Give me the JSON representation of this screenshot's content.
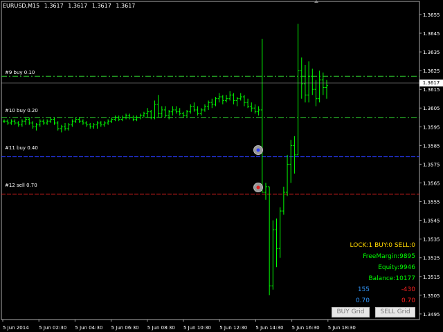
{
  "header": {
    "symbol": "EURUSD,M15",
    "ohlc": [
      "1.3617",
      "1.3617",
      "1.3617",
      "1.3617"
    ]
  },
  "orders": [
    {
      "label": "#9 buy 0.10",
      "price": 1.3622,
      "color": "#2ecc2e"
    },
    {
      "label": "#10 buy 0.20",
      "price": 1.36,
      "color": "#2ecc2e"
    },
    {
      "label": "#11 buy 0.40",
      "price": 1.3579,
      "color": "#2a3cff"
    },
    {
      "label": "#12 sell 0.70",
      "price": 1.3559,
      "color": "#e02020"
    }
  ],
  "price_axis": {
    "labels": [
      "1.3655",
      "1.3645",
      "1.3635",
      "1.3625",
      "1.3615",
      "1.3605",
      "1.3595",
      "1.3585",
      "1.3575",
      "1.3565",
      "1.3555",
      "1.3545",
      "1.3535",
      "1.3525",
      "1.3515",
      "1.3505",
      "1.3495"
    ],
    "current_price": "1.3617"
  },
  "time_axis": {
    "labels": [
      "5 Jun 2014",
      "5 Jun 02:30",
      "5 Jun 04:30",
      "5 Jun 06:30",
      "5 Jun 08:30",
      "5 Jun 10:30",
      "5 Jun 12:30",
      "5 Jun 14:30",
      "5 Jun 16:30",
      "5 Jun 18:30"
    ]
  },
  "indicator": {
    "status_line": "LOCK:1  BUY:0  SELL:0",
    "free_margin": "FreeMargin:9895",
    "equity": "Equity:9946",
    "balance": "Balance:10177",
    "buy_points": "155",
    "sell_points": "-430",
    "buy_lots": "0.70",
    "sell_lots": "0.70"
  },
  "buttons": {
    "buy_grid": "BUY Grid",
    "sell_grid": "SELL Grid"
  },
  "colors": {
    "bars": "#00ff00",
    "grid_text": "#ffffff",
    "indicator_status": "#ffd700",
    "indicator_green": "#00ff00",
    "buy_blue": "#3399ff",
    "sell_red": "#ff2020"
  },
  "chart_data": {
    "type": "bar",
    "symbol": "EURUSD",
    "timeframe": "M15",
    "ylim": [
      1.3492,
      1.3662
    ],
    "bars": [
      {
        "o": 1.3598,
        "h": 1.3599,
        "l": 1.3597,
        "c": 1.3598
      },
      {
        "o": 1.3598,
        "h": 1.3599,
        "l": 1.3596,
        "c": 1.3597
      },
      {
        "o": 1.3597,
        "h": 1.3599,
        "l": 1.3596,
        "c": 1.3598
      },
      {
        "o": 1.3598,
        "h": 1.3599,
        "l": 1.3596,
        "c": 1.3597
      },
      {
        "o": 1.3597,
        "h": 1.3598,
        "l": 1.3595,
        "c": 1.3596
      },
      {
        "o": 1.3596,
        "h": 1.3599,
        "l": 1.3595,
        "c": 1.3598
      },
      {
        "o": 1.3598,
        "h": 1.36,
        "l": 1.3596,
        "c": 1.3599
      },
      {
        "o": 1.3599,
        "h": 1.36,
        "l": 1.3596,
        "c": 1.3597
      },
      {
        "o": 1.3597,
        "h": 1.3598,
        "l": 1.3594,
        "c": 1.3595
      },
      {
        "o": 1.3595,
        "h": 1.3597,
        "l": 1.3593,
        "c": 1.3596
      },
      {
        "o": 1.3596,
        "h": 1.3599,
        "l": 1.3595,
        "c": 1.3598
      },
      {
        "o": 1.3598,
        "h": 1.3599,
        "l": 1.3596,
        "c": 1.3597
      },
      {
        "o": 1.3597,
        "h": 1.3599,
        "l": 1.3596,
        "c": 1.3598
      },
      {
        "o": 1.3598,
        "h": 1.36,
        "l": 1.3597,
        "c": 1.3599
      },
      {
        "o": 1.3599,
        "h": 1.36,
        "l": 1.3596,
        "c": 1.3597
      },
      {
        "o": 1.3597,
        "h": 1.3598,
        "l": 1.3593,
        "c": 1.3594
      },
      {
        "o": 1.3594,
        "h": 1.3596,
        "l": 1.3592,
        "c": 1.3595
      },
      {
        "o": 1.3595,
        "h": 1.3597,
        "l": 1.3593,
        "c": 1.3594
      },
      {
        "o": 1.3594,
        "h": 1.3597,
        "l": 1.3593,
        "c": 1.3596
      },
      {
        "o": 1.3596,
        "h": 1.3599,
        "l": 1.3595,
        "c": 1.3598
      },
      {
        "o": 1.3598,
        "h": 1.36,
        "l": 1.3597,
        "c": 1.3599
      },
      {
        "o": 1.3599,
        "h": 1.36,
        "l": 1.3597,
        "c": 1.3598
      },
      {
        "o": 1.3598,
        "h": 1.3599,
        "l": 1.3596,
        "c": 1.3597
      },
      {
        "o": 1.3597,
        "h": 1.3598,
        "l": 1.3595,
        "c": 1.3596
      },
      {
        "o": 1.3596,
        "h": 1.3597,
        "l": 1.3594,
        "c": 1.3595
      },
      {
        "o": 1.3595,
        "h": 1.3597,
        "l": 1.3594,
        "c": 1.3596
      },
      {
        "o": 1.3596,
        "h": 1.3598,
        "l": 1.3594,
        "c": 1.3597
      },
      {
        "o": 1.3597,
        "h": 1.3598,
        "l": 1.3595,
        "c": 1.3596
      },
      {
        "o": 1.3596,
        "h": 1.3598,
        "l": 1.3595,
        "c": 1.3597
      },
      {
        "o": 1.3597,
        "h": 1.3599,
        "l": 1.3596,
        "c": 1.3598
      },
      {
        "o": 1.3598,
        "h": 1.36,
        "l": 1.3597,
        "c": 1.3599
      },
      {
        "o": 1.3599,
        "h": 1.3601,
        "l": 1.3598,
        "c": 1.36
      },
      {
        "o": 1.36,
        "h": 1.3601,
        "l": 1.3598,
        "c": 1.3599
      },
      {
        "o": 1.3599,
        "h": 1.3601,
        "l": 1.3598,
        "c": 1.36
      },
      {
        "o": 1.36,
        "h": 1.3602,
        "l": 1.3599,
        "c": 1.3601
      },
      {
        "o": 1.3601,
        "h": 1.3602,
        "l": 1.3599,
        "c": 1.36
      },
      {
        "o": 1.36,
        "h": 1.3601,
        "l": 1.3598,
        "c": 1.3599
      },
      {
        "o": 1.3599,
        "h": 1.3601,
        "l": 1.3598,
        "c": 1.36
      },
      {
        "o": 1.36,
        "h": 1.3602,
        "l": 1.3599,
        "c": 1.3601
      },
      {
        "o": 1.3601,
        "h": 1.3603,
        "l": 1.36,
        "c": 1.3602
      },
      {
        "o": 1.3602,
        "h": 1.3605,
        "l": 1.36,
        "c": 1.3603
      },
      {
        "o": 1.3603,
        "h": 1.3604,
        "l": 1.3599,
        "c": 1.36
      },
      {
        "o": 1.36,
        "h": 1.3609,
        "l": 1.3599,
        "c": 1.3607
      },
      {
        "o": 1.3607,
        "h": 1.3612,
        "l": 1.36,
        "c": 1.3602
      },
      {
        "o": 1.3602,
        "h": 1.3606,
        "l": 1.36,
        "c": 1.3604
      },
      {
        "o": 1.3604,
        "h": 1.3606,
        "l": 1.36,
        "c": 1.3601
      },
      {
        "o": 1.3601,
        "h": 1.3604,
        "l": 1.3599,
        "c": 1.3603
      },
      {
        "o": 1.3603,
        "h": 1.3606,
        "l": 1.3601,
        "c": 1.3604
      },
      {
        "o": 1.3604,
        "h": 1.3606,
        "l": 1.3602,
        "c": 1.3603
      },
      {
        "o": 1.3603,
        "h": 1.3605,
        "l": 1.3601,
        "c": 1.3602
      },
      {
        "o": 1.3602,
        "h": 1.3603,
        "l": 1.36,
        "c": 1.3601
      },
      {
        "o": 1.3601,
        "h": 1.3604,
        "l": 1.36,
        "c": 1.3603
      },
      {
        "o": 1.3603,
        "h": 1.3607,
        "l": 1.3602,
        "c": 1.3606
      },
      {
        "o": 1.3606,
        "h": 1.3608,
        "l": 1.3603,
        "c": 1.3604
      },
      {
        "o": 1.3604,
        "h": 1.3606,
        "l": 1.3601,
        "c": 1.3602
      },
      {
        "o": 1.3602,
        "h": 1.3605,
        "l": 1.3601,
        "c": 1.3604
      },
      {
        "o": 1.3604,
        "h": 1.3607,
        "l": 1.3603,
        "c": 1.3606
      },
      {
        "o": 1.3606,
        "h": 1.3609,
        "l": 1.3604,
        "c": 1.3608
      },
      {
        "o": 1.3608,
        "h": 1.361,
        "l": 1.3605,
        "c": 1.3607
      },
      {
        "o": 1.3607,
        "h": 1.3611,
        "l": 1.3606,
        "c": 1.361
      },
      {
        "o": 1.361,
        "h": 1.3613,
        "l": 1.3608,
        "c": 1.3611
      },
      {
        "o": 1.3611,
        "h": 1.3612,
        "l": 1.3607,
        "c": 1.3609
      },
      {
        "o": 1.3609,
        "h": 1.3612,
        "l": 1.3608,
        "c": 1.361
      },
      {
        "o": 1.361,
        "h": 1.3614,
        "l": 1.3609,
        "c": 1.3612
      },
      {
        "o": 1.3612,
        "h": 1.3613,
        "l": 1.3607,
        "c": 1.3609
      },
      {
        "o": 1.3609,
        "h": 1.3611,
        "l": 1.3606,
        "c": 1.361
      },
      {
        "o": 1.361,
        "h": 1.3613,
        "l": 1.3609,
        "c": 1.3611
      },
      {
        "o": 1.3611,
        "h": 1.3612,
        "l": 1.3606,
        "c": 1.3608
      },
      {
        "o": 1.3608,
        "h": 1.361,
        "l": 1.3605,
        "c": 1.3606
      },
      {
        "o": 1.3606,
        "h": 1.3608,
        "l": 1.3603,
        "c": 1.3605
      },
      {
        "o": 1.3605,
        "h": 1.3607,
        "l": 1.3602,
        "c": 1.3603
      },
      {
        "o": 1.3603,
        "h": 1.3606,
        "l": 1.3601,
        "c": 1.3604
      },
      {
        "o": 1.3604,
        "h": 1.3642,
        "l": 1.356,
        "c": 1.356
      },
      {
        "o": 1.356,
        "h": 1.3565,
        "l": 1.3556,
        "c": 1.3563
      },
      {
        "o": 1.3563,
        "h": 1.3563,
        "l": 1.3505,
        "c": 1.351
      },
      {
        "o": 1.351,
        "h": 1.3545,
        "l": 1.3508,
        "c": 1.354
      },
      {
        "o": 1.354,
        "h": 1.3546,
        "l": 1.352,
        "c": 1.353
      },
      {
        "o": 1.353,
        "h": 1.3552,
        "l": 1.3525,
        "c": 1.355
      },
      {
        "o": 1.355,
        "h": 1.3563,
        "l": 1.3548,
        "c": 1.356
      },
      {
        "o": 1.356,
        "h": 1.358,
        "l": 1.3558,
        "c": 1.3575
      },
      {
        "o": 1.3575,
        "h": 1.3588,
        "l": 1.3565,
        "c": 1.3585
      },
      {
        "o": 1.3585,
        "h": 1.359,
        "l": 1.357,
        "c": 1.358
      },
      {
        "o": 1.358,
        "h": 1.365,
        "l": 1.358,
        "c": 1.3625
      },
      {
        "o": 1.3625,
        "h": 1.3632,
        "l": 1.361,
        "c": 1.3618
      },
      {
        "o": 1.3618,
        "h": 1.3628,
        "l": 1.3608,
        "c": 1.3612
      },
      {
        "o": 1.3612,
        "h": 1.363,
        "l": 1.3608,
        "c": 1.3622
      },
      {
        "o": 1.3622,
        "h": 1.3626,
        "l": 1.3612,
        "c": 1.3615
      },
      {
        "o": 1.3615,
        "h": 1.362,
        "l": 1.3606,
        "c": 1.361
      },
      {
        "o": 1.361,
        "h": 1.3625,
        "l": 1.3608,
        "c": 1.362
      },
      {
        "o": 1.362,
        "h": 1.3624,
        "l": 1.3612,
        "c": 1.3616
      },
      {
        "o": 1.3616,
        "h": 1.362,
        "l": 1.361,
        "c": 1.3617
      }
    ]
  }
}
